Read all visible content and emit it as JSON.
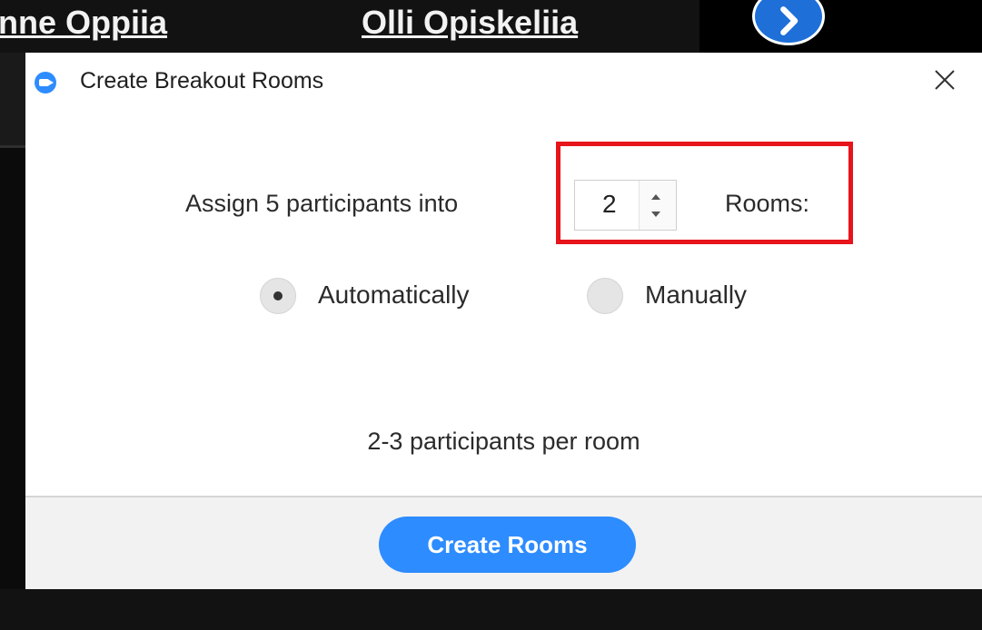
{
  "background": {
    "participant_left": "nne Oppiia",
    "participant_mid": "Olli Opiskeliia"
  },
  "dialog": {
    "title": "Create Breakout Rooms",
    "assign_label": "Assign 5 participants into",
    "rooms_count": "2",
    "rooms_label": "Rooms:",
    "options": {
      "automatically": "Automatically",
      "manually": "Manually",
      "selected": "automatically"
    },
    "per_room_text": "2-3 participants per room",
    "create_button": "Create Rooms"
  },
  "colors": {
    "accent": "#2d8cff",
    "highlight": "#e8141b"
  }
}
